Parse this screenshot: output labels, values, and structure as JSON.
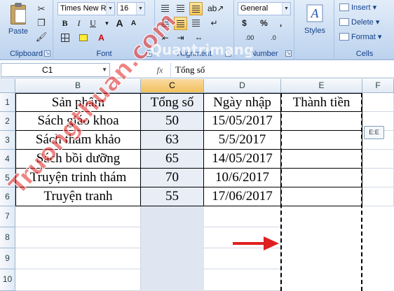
{
  "ribbon": {
    "clipboard": {
      "label": "Clipboard",
      "paste_label": "Paste"
    },
    "font": {
      "label": "Font",
      "font_name": "Times New Ro",
      "font_size": "16",
      "bold": "B",
      "italic": "I",
      "underline": "U",
      "grow_font": "A",
      "shrink_font": "A",
      "font_color_letter": "A"
    },
    "alignment": {
      "label": "Alignment"
    },
    "number": {
      "label": "Number",
      "format": "General",
      "currency": "$",
      "percent": "%",
      "comma": ",",
      "inc_decimal": ".00",
      "dec_decimal": ".0"
    },
    "styles": {
      "label": "Styles",
      "button_label": "Styles"
    },
    "cells": {
      "label": "Cells",
      "insert": "Insert",
      "delete": "Delete",
      "format": "Format"
    }
  },
  "formula_bar": {
    "name_box": "C1",
    "fx": "fx",
    "content": "Tổng số"
  },
  "sheet": {
    "columns": [
      "B",
      "C",
      "D",
      "E",
      "F"
    ],
    "rows": [
      "1",
      "2",
      "3",
      "4",
      "5",
      "6",
      "7",
      "8",
      "9",
      "10"
    ],
    "headers": [
      "Sản phẩm",
      "Tổng số",
      "Ngày nhập",
      "Thành tiền"
    ],
    "data": [
      [
        "Sách giáo khoa",
        "50",
        "15/05/2017"
      ],
      [
        "Sách tham khảo",
        "63",
        "5/5/2017"
      ],
      [
        "Sách bồi dưỡng",
        "65",
        "14/05/2017"
      ],
      [
        "Truyện trinh thám",
        "70",
        "10/6/2017"
      ],
      [
        "Truyện tranh",
        "55",
        "17/06/2017"
      ]
    ],
    "paste_options_tag": "E:E"
  },
  "watermark": {
    "left_text": "Truongthuan.com",
    "center_text": "Quantrimang"
  },
  "colors": {
    "ribbon": "#c7daf1",
    "selection": "#ffc95c",
    "arrow": "#e02020",
    "watermark_red": "#e0201d",
    "watermark_blue": "#1e50b4"
  }
}
